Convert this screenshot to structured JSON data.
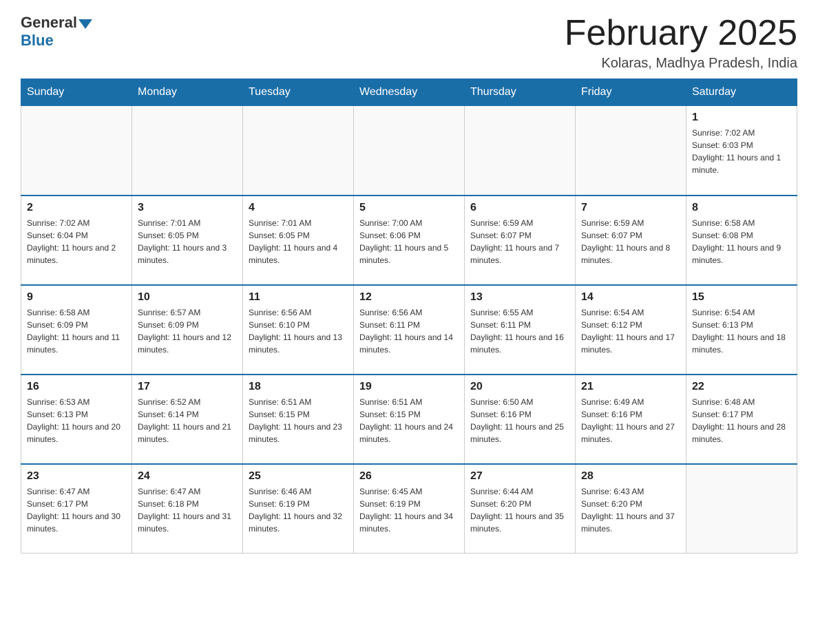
{
  "header": {
    "logo_general": "General",
    "logo_blue": "Blue",
    "month_title": "February 2025",
    "location": "Kolaras, Madhya Pradesh, India"
  },
  "days_of_week": [
    "Sunday",
    "Monday",
    "Tuesday",
    "Wednesday",
    "Thursday",
    "Friday",
    "Saturday"
  ],
  "weeks": [
    [
      {
        "day": "",
        "info": ""
      },
      {
        "day": "",
        "info": ""
      },
      {
        "day": "",
        "info": ""
      },
      {
        "day": "",
        "info": ""
      },
      {
        "day": "",
        "info": ""
      },
      {
        "day": "",
        "info": ""
      },
      {
        "day": "1",
        "info": "Sunrise: 7:02 AM\nSunset: 6:03 PM\nDaylight: 11 hours and 1 minute."
      }
    ],
    [
      {
        "day": "2",
        "info": "Sunrise: 7:02 AM\nSunset: 6:04 PM\nDaylight: 11 hours and 2 minutes."
      },
      {
        "day": "3",
        "info": "Sunrise: 7:01 AM\nSunset: 6:05 PM\nDaylight: 11 hours and 3 minutes."
      },
      {
        "day": "4",
        "info": "Sunrise: 7:01 AM\nSunset: 6:05 PM\nDaylight: 11 hours and 4 minutes."
      },
      {
        "day": "5",
        "info": "Sunrise: 7:00 AM\nSunset: 6:06 PM\nDaylight: 11 hours and 5 minutes."
      },
      {
        "day": "6",
        "info": "Sunrise: 6:59 AM\nSunset: 6:07 PM\nDaylight: 11 hours and 7 minutes."
      },
      {
        "day": "7",
        "info": "Sunrise: 6:59 AM\nSunset: 6:07 PM\nDaylight: 11 hours and 8 minutes."
      },
      {
        "day": "8",
        "info": "Sunrise: 6:58 AM\nSunset: 6:08 PM\nDaylight: 11 hours and 9 minutes."
      }
    ],
    [
      {
        "day": "9",
        "info": "Sunrise: 6:58 AM\nSunset: 6:09 PM\nDaylight: 11 hours and 11 minutes."
      },
      {
        "day": "10",
        "info": "Sunrise: 6:57 AM\nSunset: 6:09 PM\nDaylight: 11 hours and 12 minutes."
      },
      {
        "day": "11",
        "info": "Sunrise: 6:56 AM\nSunset: 6:10 PM\nDaylight: 11 hours and 13 minutes."
      },
      {
        "day": "12",
        "info": "Sunrise: 6:56 AM\nSunset: 6:11 PM\nDaylight: 11 hours and 14 minutes."
      },
      {
        "day": "13",
        "info": "Sunrise: 6:55 AM\nSunset: 6:11 PM\nDaylight: 11 hours and 16 minutes."
      },
      {
        "day": "14",
        "info": "Sunrise: 6:54 AM\nSunset: 6:12 PM\nDaylight: 11 hours and 17 minutes."
      },
      {
        "day": "15",
        "info": "Sunrise: 6:54 AM\nSunset: 6:13 PM\nDaylight: 11 hours and 18 minutes."
      }
    ],
    [
      {
        "day": "16",
        "info": "Sunrise: 6:53 AM\nSunset: 6:13 PM\nDaylight: 11 hours and 20 minutes."
      },
      {
        "day": "17",
        "info": "Sunrise: 6:52 AM\nSunset: 6:14 PM\nDaylight: 11 hours and 21 minutes."
      },
      {
        "day": "18",
        "info": "Sunrise: 6:51 AM\nSunset: 6:15 PM\nDaylight: 11 hours and 23 minutes."
      },
      {
        "day": "19",
        "info": "Sunrise: 6:51 AM\nSunset: 6:15 PM\nDaylight: 11 hours and 24 minutes."
      },
      {
        "day": "20",
        "info": "Sunrise: 6:50 AM\nSunset: 6:16 PM\nDaylight: 11 hours and 25 minutes."
      },
      {
        "day": "21",
        "info": "Sunrise: 6:49 AM\nSunset: 6:16 PM\nDaylight: 11 hours and 27 minutes."
      },
      {
        "day": "22",
        "info": "Sunrise: 6:48 AM\nSunset: 6:17 PM\nDaylight: 11 hours and 28 minutes."
      }
    ],
    [
      {
        "day": "23",
        "info": "Sunrise: 6:47 AM\nSunset: 6:17 PM\nDaylight: 11 hours and 30 minutes."
      },
      {
        "day": "24",
        "info": "Sunrise: 6:47 AM\nSunset: 6:18 PM\nDaylight: 11 hours and 31 minutes."
      },
      {
        "day": "25",
        "info": "Sunrise: 6:46 AM\nSunset: 6:19 PM\nDaylight: 11 hours and 32 minutes."
      },
      {
        "day": "26",
        "info": "Sunrise: 6:45 AM\nSunset: 6:19 PM\nDaylight: 11 hours and 34 minutes."
      },
      {
        "day": "27",
        "info": "Sunrise: 6:44 AM\nSunset: 6:20 PM\nDaylight: 11 hours and 35 minutes."
      },
      {
        "day": "28",
        "info": "Sunrise: 6:43 AM\nSunset: 6:20 PM\nDaylight: 11 hours and 37 minutes."
      },
      {
        "day": "",
        "info": ""
      }
    ]
  ]
}
